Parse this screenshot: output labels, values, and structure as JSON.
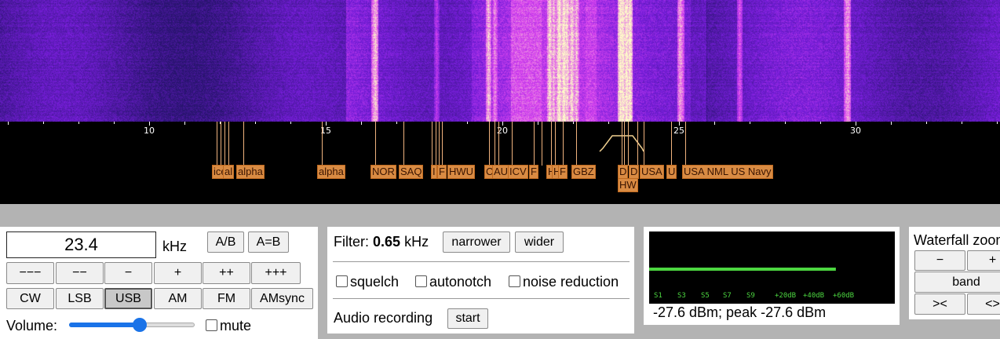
{
  "scale": {
    "ticks": [
      "10",
      "15",
      "20",
      "25",
      "30"
    ],
    "markers": [
      "ice",
      "al",
      "alpha",
      "alpha",
      "NOR",
      "SAQ",
      "I",
      "F",
      "HWU",
      "C",
      "AU",
      "ICV",
      "F",
      "H",
      "H",
      "F",
      "GBZ",
      "D",
      "D",
      "HW",
      "USA",
      "U",
      "USA NML US Navy"
    ]
  },
  "frequency": {
    "value": "23.4",
    "unit": "kHz"
  },
  "buttons": {
    "ab": "A/B",
    "a_eq_b": "A=B"
  },
  "step_buttons": [
    "−−−",
    "−−",
    "−",
    "+",
    "++",
    "+++"
  ],
  "modes": [
    "CW",
    "LSB",
    "USB",
    "AM",
    "FM",
    "AMsync"
  ],
  "selected_mode": "USB",
  "volume": {
    "label": "Volume:",
    "level": 0.56
  },
  "mute_label": "mute",
  "filter": {
    "label": "Filter:",
    "value": "0.65",
    "unit": "kHz",
    "narrower": "narrower",
    "wider": "wider"
  },
  "options": {
    "squelch": "squelch",
    "autonotch": "autonotch",
    "noise_reduction": "noise reduction"
  },
  "recording": {
    "label": "Audio recording",
    "start": "start"
  },
  "smeter": {
    "scale_labels": [
      "S1",
      "S3",
      "S5",
      "S7",
      "S9",
      "+20dB",
      "+40dB",
      "+60dB"
    ],
    "level": 0.76,
    "reading": "-27.6 dBm; peak  -27.6 dBm"
  },
  "waterfall_zoom": {
    "label": "Waterfall zoom",
    "minus": "−",
    "plus": "+",
    "band": "band",
    "left": "><",
    "right": "<>"
  },
  "colors": {
    "waterfall_low": "#2a1a7a",
    "waterfall_high": "#ffffc8",
    "marker_bg": "#d98b43",
    "smeter_bar": "#4cd640"
  }
}
